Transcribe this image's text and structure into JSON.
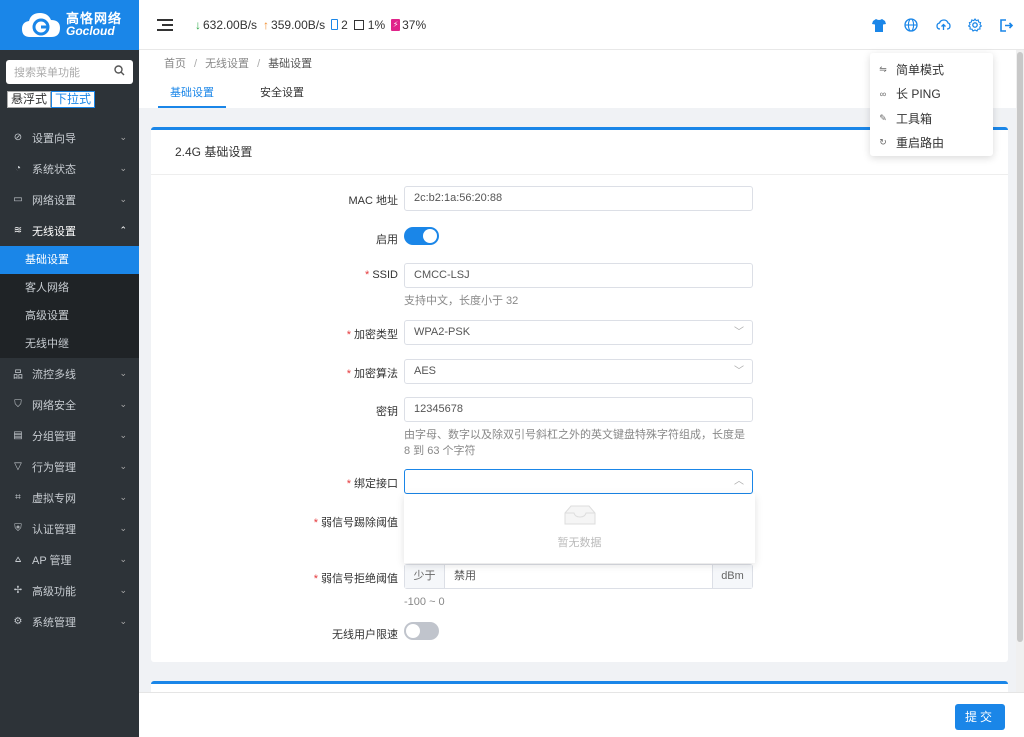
{
  "logo": {
    "cn": "高恪网络",
    "en": "Gocloud"
  },
  "sidebar": {
    "search_placeholder": "搜索菜单功能",
    "modes": [
      "悬浮式",
      "下拉式"
    ],
    "items": [
      {
        "label": "设置向导",
        "icon": "compass-icon"
      },
      {
        "label": "系统状态",
        "icon": "gauge-icon"
      },
      {
        "label": "网络设置",
        "icon": "monitor-icon"
      },
      {
        "label": "无线设置",
        "icon": "wifi-icon"
      },
      {
        "label": "流控多线",
        "icon": "sitemap-icon"
      },
      {
        "label": "网络安全",
        "icon": "shield-icon"
      },
      {
        "label": "分组管理",
        "icon": "list-icon"
      },
      {
        "label": "行为管理",
        "icon": "filter-icon"
      },
      {
        "label": "虚拟专网",
        "icon": "vpn-icon"
      },
      {
        "label": "认证管理",
        "icon": "shield-check-icon"
      },
      {
        "label": "AP 管理",
        "icon": "network-icon"
      },
      {
        "label": "高级功能",
        "icon": "pin-icon"
      },
      {
        "label": "系统管理",
        "icon": "gear-icon"
      }
    ],
    "submenu": [
      "基础设置",
      "客人网络",
      "高级设置",
      "无线中继"
    ]
  },
  "topbar": {
    "download": "632.00B/s",
    "upload": "359.00B/s",
    "devices": "2",
    "cpu": "1%",
    "battery": "37%"
  },
  "tool_menu": [
    "简单模式",
    "长 PING",
    "工具箱",
    "重启路由"
  ],
  "breadcrumb": [
    "首页",
    "无线设置",
    "基础设置"
  ],
  "tabs": [
    "基础设置",
    "安全设置"
  ],
  "card": {
    "title": "2.4G 基础设置",
    "mac_label": "MAC 地址",
    "mac_value": "2c:b2:1a:56:20:88",
    "enable_label": "启用",
    "ssid_label": "SSID",
    "ssid_value": "CMCC-LSJ",
    "ssid_hint": "支持中文，长度小于 32",
    "enc_type_label": "加密类型",
    "enc_type_value": "WPA2-PSK",
    "enc_algo_label": "加密算法",
    "enc_algo_value": "AES",
    "key_label": "密钥",
    "key_value": "12345678",
    "key_hint": "由字母、数字以及除双引号斜杠之外的英文键盘特殊字符组成，长度是 8 到 63 个字符",
    "bind_label": "绑定接口",
    "bind_empty": "暂无数据",
    "weak_kick_label": "弱信号踢除阈值",
    "weak_reject_label": "弱信号拒绝阈值",
    "weak_reject_prefix": "少于",
    "weak_reject_value": "禁用",
    "weak_reject_unit": "dBm",
    "weak_reject_hint": "-100 ~ 0",
    "rate_limit_label": "无线用户限速"
  },
  "submit_label": "提交"
}
